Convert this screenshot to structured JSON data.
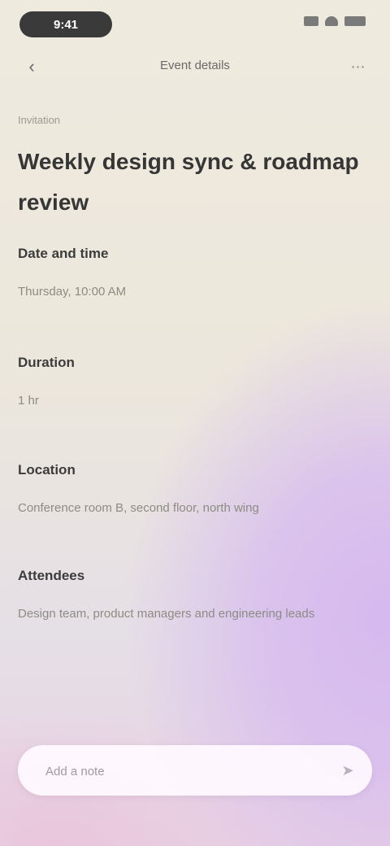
{
  "status_bar": {
    "time": "9:41",
    "icons": [
      "signal-icon",
      "wifi-icon",
      "battery-icon"
    ]
  },
  "nav": {
    "back_icon": "chevron-left-icon",
    "title": "Event details",
    "more_icon": "more-icon"
  },
  "event": {
    "eyebrow": "Invitation",
    "title": "Weekly design sync & roadmap review",
    "sections": [
      {
        "label": "Date and time",
        "value": "Thursday, 10:00 AM"
      },
      {
        "label": "Duration",
        "value": "1 hr"
      },
      {
        "label": "Location",
        "value": "Conference room B, second floor, north wing"
      },
      {
        "label": "Attendees",
        "value": "Design team, product managers and engineering leads"
      }
    ]
  },
  "composer": {
    "placeholder": "Add a note",
    "send_icon": "send-icon"
  },
  "colors": {
    "background_base": "#ece7dc",
    "gradient_accent": "#d6b9ef",
    "status_pill": "#3a3a3a"
  }
}
